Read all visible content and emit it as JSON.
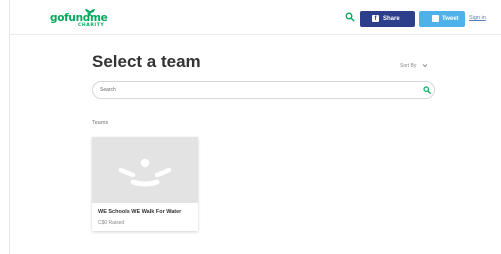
{
  "header": {
    "logo_text": "gofundme",
    "logo_sub": "CHARITY",
    "search_icon": "search-icon",
    "share_label": "Share",
    "tweet_label": "Tweet",
    "signin_label": "Sign in"
  },
  "main": {
    "title": "Select a team",
    "sort_label": "Sort By",
    "search_placeholder": "Search",
    "teams_label": "Teams"
  },
  "teams": [
    {
      "name": "WE Schools WE Walk For Water",
      "raised": "C$0 Raised"
    }
  ],
  "colors": {
    "brand": "#02a95c",
    "share": "#2d3e8a",
    "tweet": "#4fb1e9",
    "link": "#5a7fb5"
  }
}
